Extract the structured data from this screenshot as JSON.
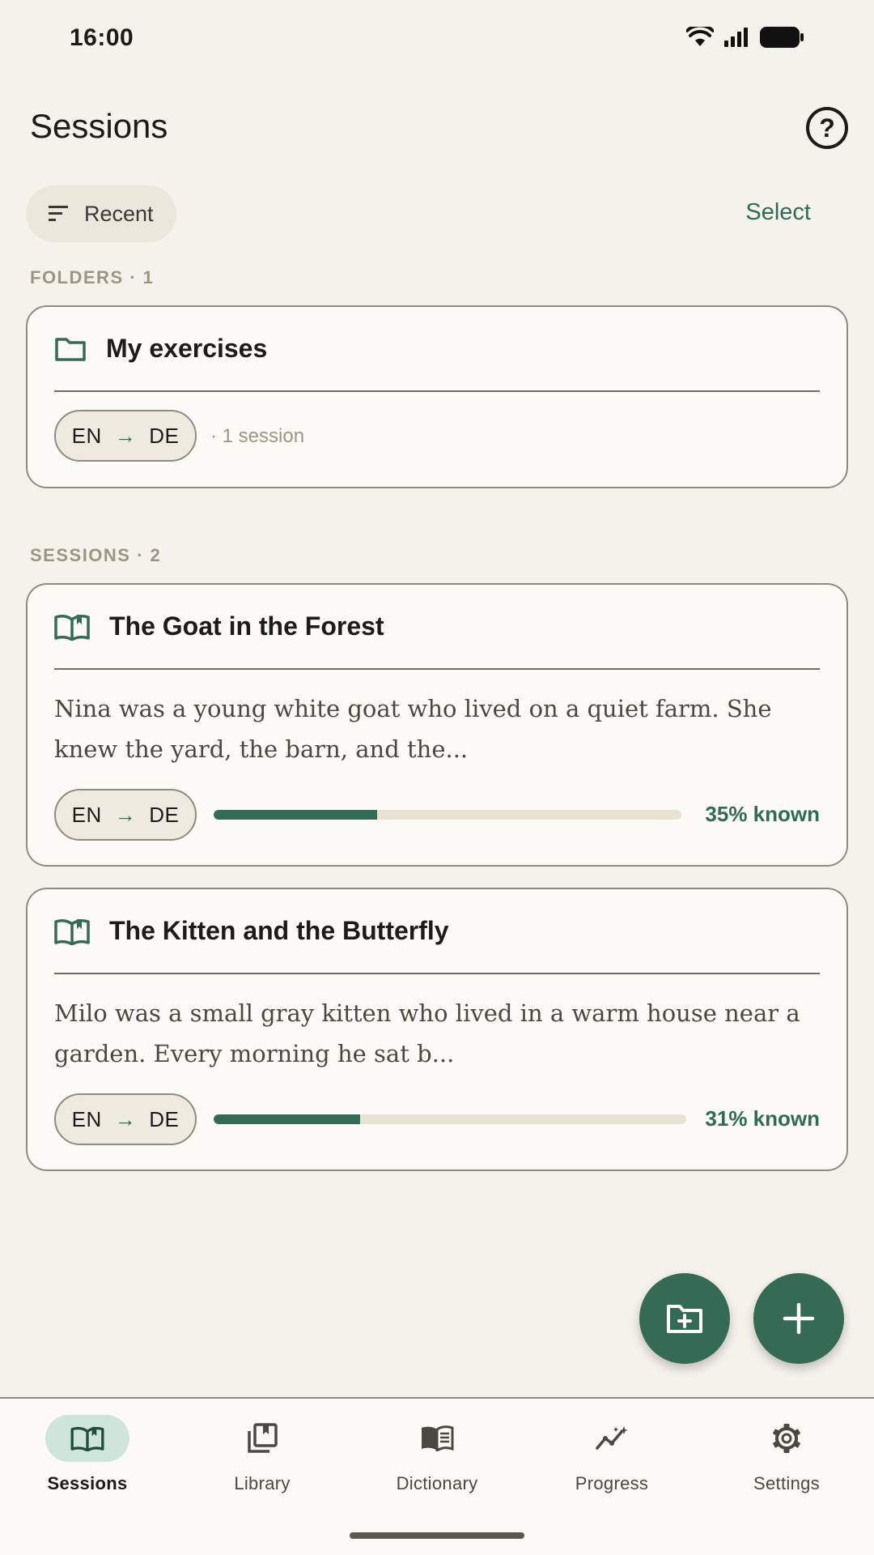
{
  "status_bar": {
    "time": "16:00"
  },
  "header": {
    "title": "Sessions",
    "help_symbol": "?"
  },
  "toolbar": {
    "sort_label": "Recent",
    "select_label": "Select"
  },
  "folders_section": {
    "label": "FOLDERS · 1",
    "items": [
      {
        "name": "My exercises",
        "source_lang": "EN",
        "target_lang": "DE",
        "meta": "· 1 session"
      }
    ]
  },
  "sessions_section": {
    "label": "SESSIONS · 2",
    "items": [
      {
        "title": "The Goat in the Forest",
        "excerpt": "Nina was a young white goat who lived on a quiet farm. She knew the yard, the barn, and the...",
        "source_lang": "EN",
        "target_lang": "DE",
        "progress": 0.35,
        "known_label": "35% known"
      },
      {
        "title": "The Kitten and the Butterfly",
        "excerpt": "Milo was a small gray kitten who lived in a warm house near a garden. Every morning he sat b...",
        "source_lang": "EN",
        "target_lang": "DE",
        "progress": 0.31,
        "known_label": "31% known"
      }
    ]
  },
  "fabs": {
    "new_folder_icon": "folder-plus-icon",
    "add_icon": "plus-icon"
  },
  "bottom_nav": [
    {
      "label": "Sessions",
      "icon": "book-open-icon",
      "active": true
    },
    {
      "label": "Library",
      "icon": "library-icon",
      "active": false
    },
    {
      "label": "Dictionary",
      "icon": "dictionary-icon",
      "active": false
    },
    {
      "label": "Progress",
      "icon": "progress-chart-icon",
      "active": false
    },
    {
      "label": "Settings",
      "icon": "gear-icon",
      "active": false
    }
  ],
  "colors": {
    "accent": "#356a55",
    "background": "#f5f1eb",
    "card": "#fbfaf6",
    "track": "#e8e2d2"
  }
}
